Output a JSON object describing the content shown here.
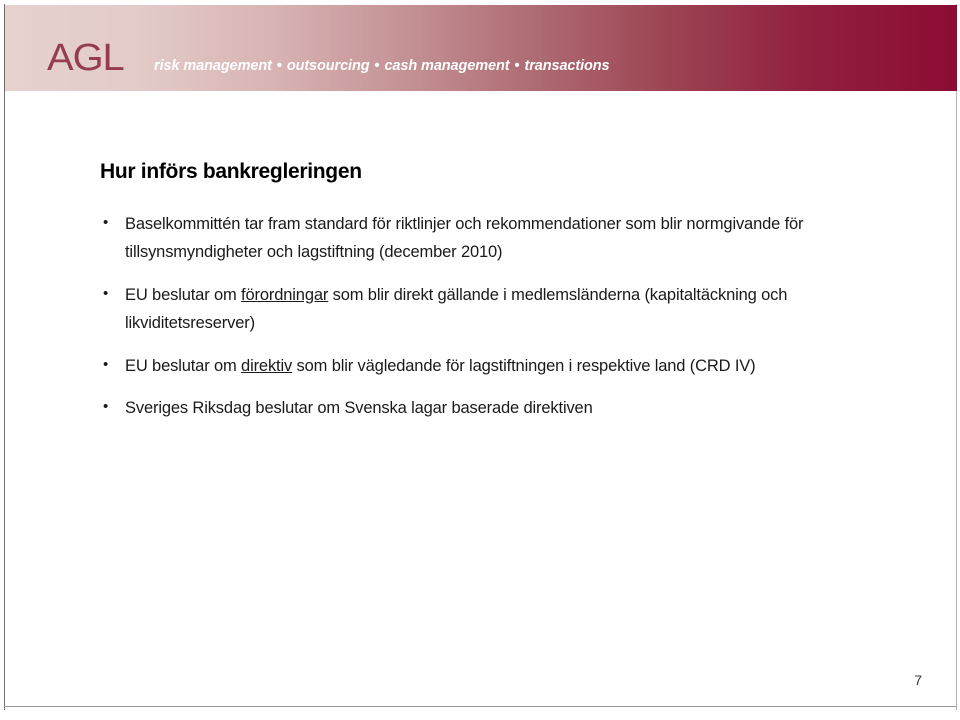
{
  "slide": {
    "page_number": "7",
    "background_color": "#ffffff"
  },
  "header": {
    "logo_text": "AGL",
    "logo_color": "#8a2840",
    "gradient_start_color": "#e6d2cf",
    "gradient_end_color": "#8b0c33",
    "tagline_color": "#ffffff",
    "tagline_separator": "•",
    "tagline_items": [
      "risk management",
      "outsourcing",
      "cash management",
      "transactions"
    ],
    "tagline_full": "risk management • outsourcing • cash management • transactions"
  },
  "main": {
    "title": "Hur införs bankregleringen",
    "bullets": [
      {
        "id": "bullet-baselkommitten",
        "parts": [
          {
            "text": "Baselkommittén tar fram standard för riktlinjer och rekommendationer som blir normgivande för tillsynsmyndigheter och lagstiftning (december 2010)",
            "underline": false
          }
        ],
        "plain": "Baselkommittén tar fram standard för riktlinjer och rekommendationer som blir normgivande för tillsynsmyndigheter och lagstiftning (december 2010)"
      },
      {
        "id": "bullet-forordningar",
        "parts": [
          {
            "text": "EU beslutar om ",
            "underline": false
          },
          {
            "text": "förordningar",
            "underline": true
          },
          {
            "text": " som blir direkt gällande i medlemsländerna (kapitaltäckning och likviditetsreserver)",
            "underline": false
          }
        ],
        "plain": "EU beslutar om förordningar som blir direkt gällande i medlemsländerna (kapitaltäckning och likviditetsreserver)"
      },
      {
        "id": "bullet-direktiv",
        "parts": [
          {
            "text": "EU beslutar om ",
            "underline": false
          },
          {
            "text": "direktiv",
            "underline": true
          },
          {
            "text": " som blir vägledande för lagstiftningen i respektive land (CRD IV)",
            "underline": false
          }
        ],
        "plain": "EU beslutar om direktiv som blir vägledande för lagstiftningen i respektive land (CRD IV)"
      },
      {
        "id": "bullet-riksdag",
        "parts": [
          {
            "text": "Sveriges Riksdag beslutar om Svenska lagar baserade direktiven",
            "underline": false
          }
        ],
        "plain": "Sveriges Riksdag beslutar om Svenska lagar baserade direktiven"
      }
    ]
  }
}
